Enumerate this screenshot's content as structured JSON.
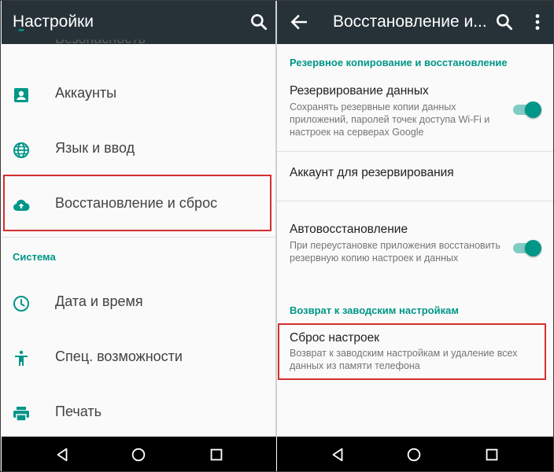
{
  "left": {
    "title": "Настройки",
    "items": [
      {
        "label": "Безопасность",
        "icon": "lock-icon"
      },
      {
        "label": "Аккаунты",
        "icon": "account-box-icon"
      },
      {
        "label": "Язык и ввод",
        "icon": "globe-icon"
      },
      {
        "label": "Восстановление и сброс",
        "icon": "cloud-upload-icon"
      },
      {
        "label": "Дата и время",
        "icon": "clock-icon"
      },
      {
        "label": "Спец. возможности",
        "icon": "accessibility-icon"
      },
      {
        "label": "Печать",
        "icon": "printer-icon"
      }
    ],
    "section_system": "Система"
  },
  "right": {
    "title": "Восстановление и...",
    "section_backup": "Резервное копирование и восстановление",
    "backup_data": {
      "title": "Резервирование данных",
      "summary": "Сохранять резервные копии данных приложений, паролей точек доступа Wi-Fi и настроек на серверах Google",
      "enabled": true
    },
    "backup_account": {
      "title": "Аккаунт для резервирования"
    },
    "auto_restore": {
      "title": "Автовосстановление",
      "summary": "При переустановке приложения восстановить резервную копию настроек и данных",
      "enabled": true
    },
    "section_factory": "Возврат к заводским настройкам",
    "factory_reset": {
      "title": "Сброс настроек",
      "summary": "Возврат к заводским настройкам и удаление всех данных из памяти телефона"
    }
  },
  "colors": {
    "appbar": "#263238",
    "accent": "#009688",
    "highlight": "#d32f2f",
    "icon": "#009688"
  }
}
